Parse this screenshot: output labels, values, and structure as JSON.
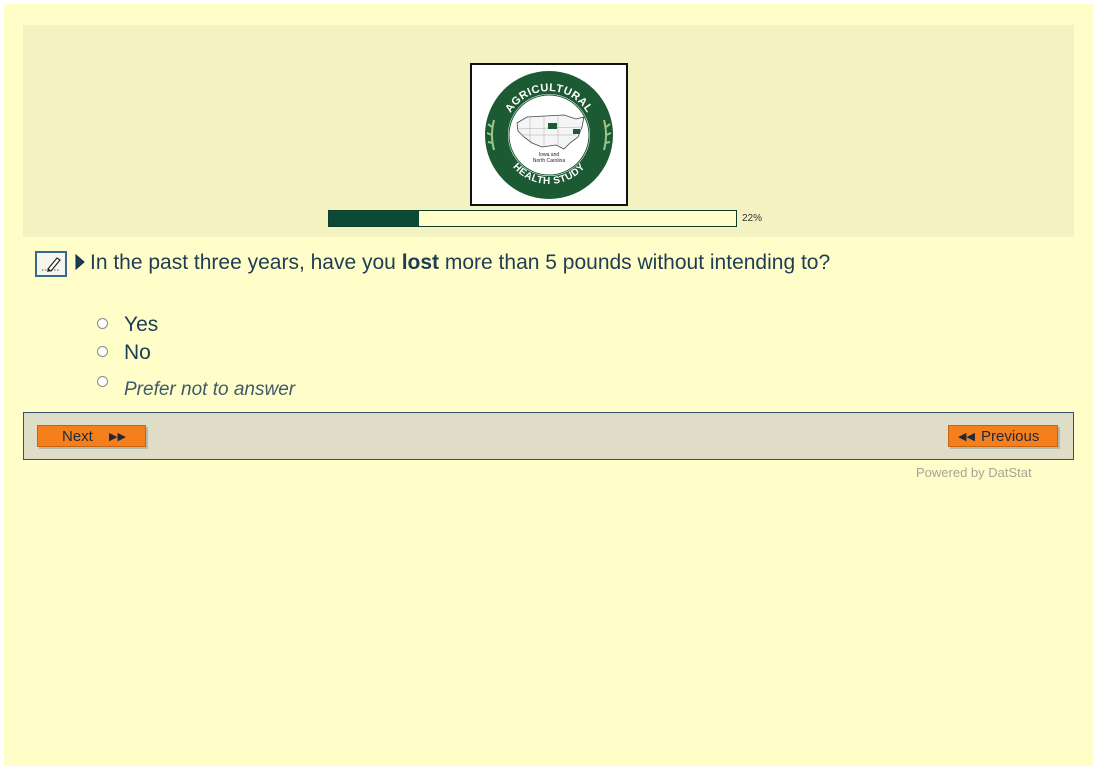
{
  "logo": {
    "top_text": "AGRICULTURAL",
    "bottom_text": "HEALTH STUDY",
    "center_text_1": "Iowa and",
    "center_text_2": "North Carolina"
  },
  "progress": {
    "percent_label": "22%",
    "fraction": 0.22
  },
  "question": {
    "edit_icon": "pencil-edit-icon",
    "pointer_icon": "triangle-right-icon",
    "text_before": "In the past three years, have you ",
    "text_bold": "lost",
    "text_after": " more than 5 pounds without intending to?"
  },
  "options": [
    {
      "label": "Yes"
    },
    {
      "label": "No"
    },
    {
      "label": "Prefer not to answer"
    }
  ],
  "navigation": {
    "next_label": "Next",
    "next_icon": "double-chevron-right-icon",
    "previous_label": "Previous",
    "previous_icon": "double-chevron-left-icon"
  },
  "footer": {
    "powered_by": "Powered by DatStat"
  },
  "colors": {
    "page_background": "#fffdc8",
    "header_background": "#f4f2c0",
    "progress_fill": "#0d4a35",
    "question_text": "#1d3d55",
    "button": "#f57f1d",
    "nav_bar": "#dfdcc8"
  }
}
